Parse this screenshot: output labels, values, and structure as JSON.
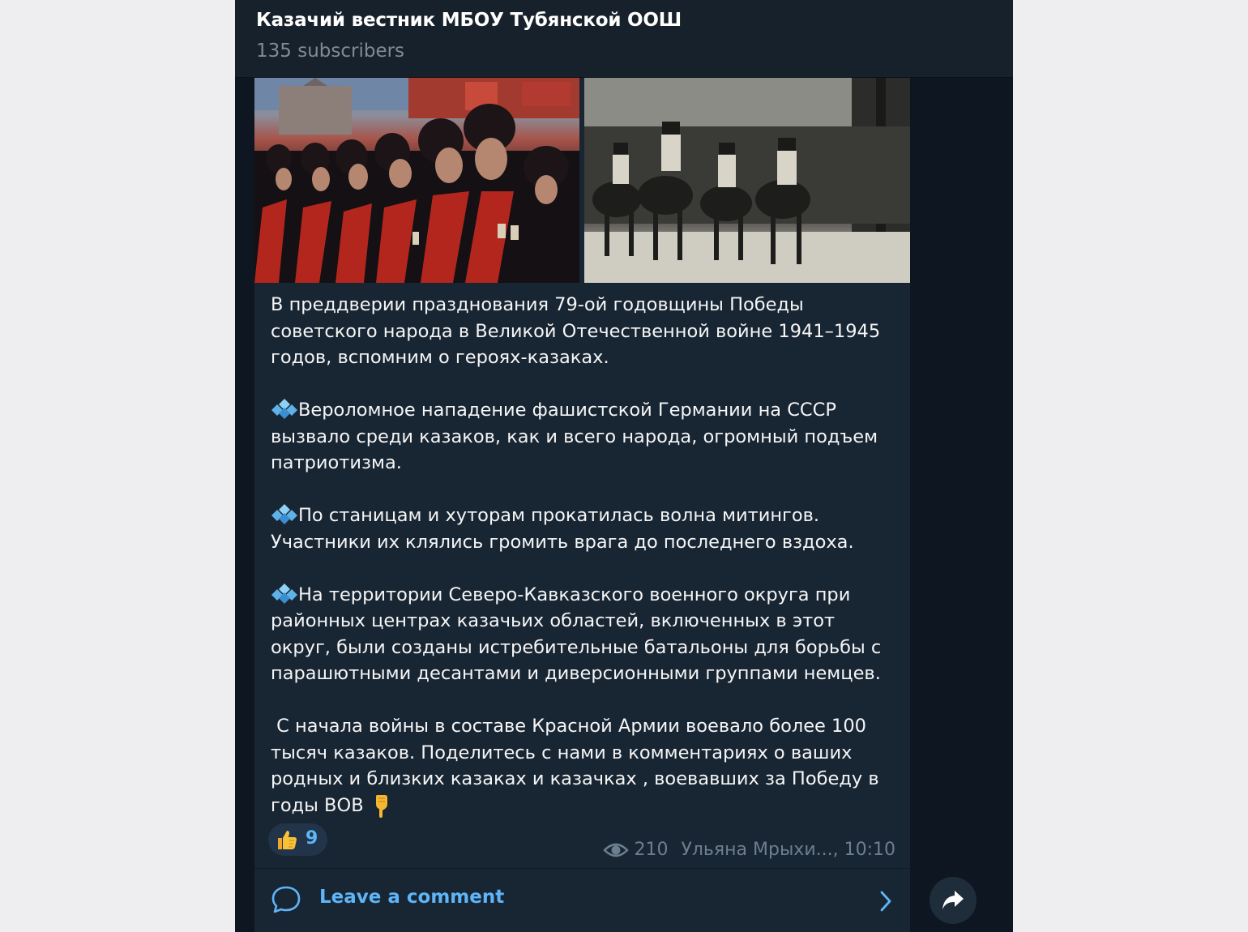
{
  "channel": {
    "title": "Казачий вестник МБОУ Тубянской ООШ",
    "subtitle": "135 subscribers"
  },
  "photos": [
    {
      "name": "cossack-parade-photo"
    },
    {
      "name": "cossack-cavalry-photo"
    }
  ],
  "message": {
    "p1": "В преддверии празднования 79-ой годовщины Победы советского народа в Великой Отечественной войне 1941–1945 годов, вспомним о героях-казаках.",
    "p2": "Вероломное нападение фашистской Германии на СССР вызвало среди казаков, как и всего народа, огромный подъем патриотизма.",
    "p3": "По станицам и хуторам прокатилась волна митингов. Участники их клялись громить врага до последнего вздоха.",
    "p4": "На территории Северо-Кавказского военного округа при районных центрах казачьих областей, включенных в этот округ, были созданы истребительные батальоны для борьбы с парашютными десантами и диверсионными группами немцев.",
    "p5": " С начала войны в составе Красной Армии воевало более 100 тысяч казаков. Поделитесь с нами в комментариях о ваших родных и близких казаках и казачках , воевавших за Победу в годы ВОВ"
  },
  "reaction": {
    "icon": "thumbs-up-icon",
    "count": "9"
  },
  "meta": {
    "views": "210",
    "author_time": "Ульяна Мрыхи..., 10:10"
  },
  "comment": {
    "label": "Leave a comment"
  },
  "colors": {
    "accent": "#5eb5f7",
    "bubble": "#182533",
    "header": "#17212b",
    "background": "#0e1621"
  }
}
